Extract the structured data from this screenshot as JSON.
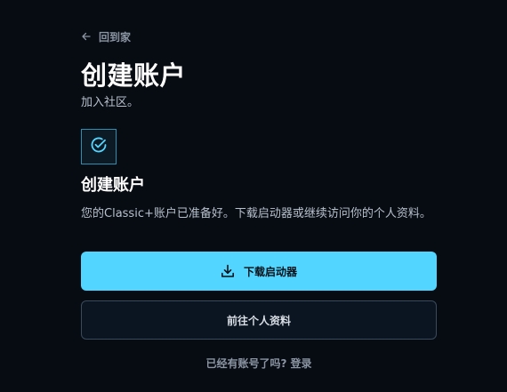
{
  "back_link": {
    "label": "回到家",
    "icon": "arrow-left-icon"
  },
  "header": {
    "title": "创建账户",
    "subtitle": "加入社区。"
  },
  "status": {
    "icon": "check-circle-icon",
    "title": "创建账户",
    "description": "您的Classic+账户已准备好。下载启动器或继续访问你的个人资料。"
  },
  "actions": {
    "download_label": "下载启动器",
    "download_icon": "download-icon",
    "profile_label": "前往个人资料"
  },
  "footer": {
    "prompt": "已经有账号了吗?",
    "login_label": "登录"
  },
  "colors": {
    "background": "#070b12",
    "accent": "#52d6ff",
    "muted_text": "#8a94a3",
    "body_text": "#b8c0cc"
  }
}
